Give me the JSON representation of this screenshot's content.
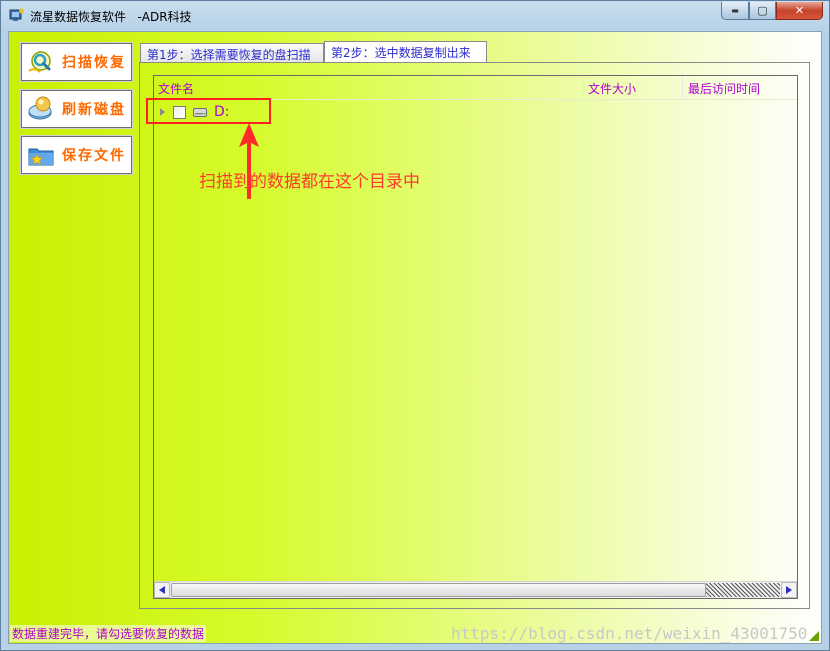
{
  "window": {
    "title": "流星数据恢复软件   -ADR科技",
    "controls": {
      "minimize": "▬",
      "maximize": "▢",
      "close": "✕"
    }
  },
  "sidebar": {
    "items": [
      {
        "label": "扫描恢复",
        "icon": "magnifier-icon"
      },
      {
        "label": "刷新磁盘",
        "icon": "disk-bubble-icon"
      },
      {
        "label": "保存文件",
        "icon": "save-folder-icon"
      }
    ]
  },
  "tabs": [
    {
      "label": "第1步：选择需要恢复的盘扫描",
      "active": false
    },
    {
      "label": "第2步：选中数据复制出来",
      "active": true
    }
  ],
  "tree": {
    "columns": [
      "文件名",
      "文件大小",
      "最后访问时间"
    ],
    "rows": [
      {
        "label": "D:",
        "checked": false,
        "expanded": false,
        "icon": "drive-icon"
      }
    ]
  },
  "annotation": {
    "text": "扫描到的数据都在这个目录中",
    "color": "#ff3b2e"
  },
  "status_bar": {
    "text": "数据重建完毕，请勾选要恢复的数据"
  },
  "watermark": "https://blog.csdn.net/weixin_43001750",
  "colors": {
    "accent_text": "#b000d0",
    "button_text": "#ff6a00",
    "background_green": "#c8f000"
  }
}
